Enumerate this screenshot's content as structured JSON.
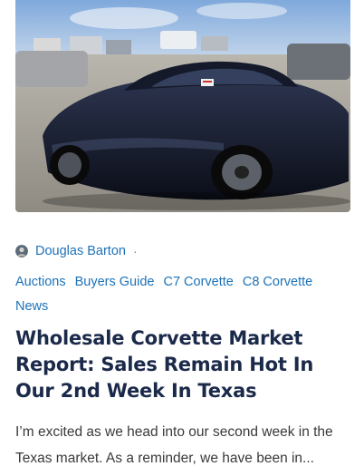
{
  "post": {
    "author": "Douglas Barton",
    "separator": "·",
    "categories": [
      "Auctions",
      "Buyers Guide",
      "C7 Corvette",
      "C8 Corvette",
      "News"
    ],
    "title": "Wholesale Corvette Market Report: Sales Remain Hot In Our 2nd Week In Texas",
    "excerpt": "I’m excited as we head into our second week in the Texas market. As a reminder, we have been in..."
  },
  "colors": {
    "link": "#1d72b8",
    "title": "#1b2a4a",
    "body_text": "#3a3a3a"
  },
  "icons": {
    "hero": "car-photo",
    "avatar": "author-avatar"
  }
}
